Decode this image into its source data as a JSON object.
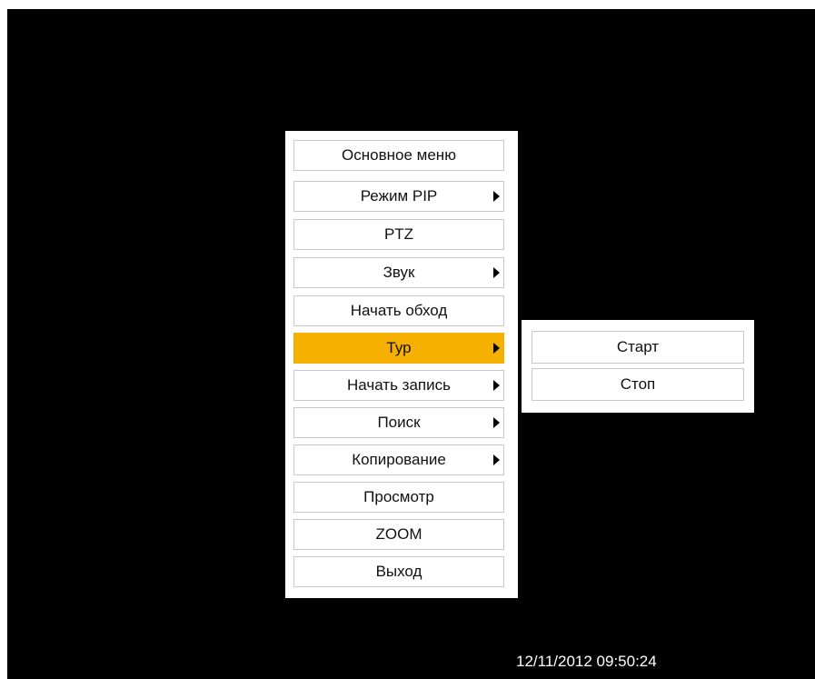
{
  "main_menu": {
    "items": [
      {
        "label": "Основное меню",
        "has_submenu": false,
        "selected": false
      },
      {
        "label": "Режим PIP",
        "has_submenu": true,
        "selected": false
      },
      {
        "label": "PTZ",
        "has_submenu": false,
        "selected": false
      },
      {
        "label": "Звук",
        "has_submenu": true,
        "selected": false
      },
      {
        "label": "Начать обход",
        "has_submenu": false,
        "selected": false
      },
      {
        "label": "Тур",
        "has_submenu": true,
        "selected": true
      },
      {
        "label": "Начать запись",
        "has_submenu": true,
        "selected": false
      },
      {
        "label": "Поиск",
        "has_submenu": true,
        "selected": false
      },
      {
        "label": "Копирование",
        "has_submenu": true,
        "selected": false
      },
      {
        "label": "Просмотр",
        "has_submenu": false,
        "selected": false
      },
      {
        "label": "ZOOM",
        "has_submenu": false,
        "selected": false
      },
      {
        "label": "Выход",
        "has_submenu": false,
        "selected": false
      }
    ]
  },
  "submenu": {
    "items": [
      {
        "label": "Старт"
      },
      {
        "label": "Стоп"
      }
    ]
  },
  "status": {
    "datetime": "12/11/2012 09:50:24"
  },
  "colors": {
    "background": "#000000",
    "menu_background": "#ffffff",
    "selected": "#f6b000",
    "text": "#111111",
    "datetime_text": "#ffffff"
  },
  "icons": {
    "submenu_arrow": "triangle-right-icon"
  }
}
